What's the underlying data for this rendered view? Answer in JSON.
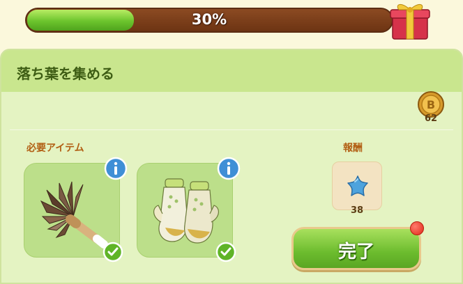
{
  "progress": {
    "label": "30%",
    "value": 0.3
  },
  "quest": {
    "title": "落ち葉を集める"
  },
  "coins": {
    "count": "62",
    "icon": "coin-icon"
  },
  "required_items": {
    "label": "必要アイテム",
    "items": [
      {
        "name_icon": "feather-duster-icon",
        "status": "check-icon"
      },
      {
        "name_icon": "gardening-gloves-icon",
        "status": "check-icon"
      }
    ]
  },
  "reward": {
    "label": "報酬",
    "count": "38",
    "icon": "blue-star-icon"
  },
  "complete_button": {
    "label": "完了"
  },
  "colors": {
    "accent": "#6cc42d",
    "bar_track": "#7a3d19",
    "panel": "#e4f3c2"
  }
}
